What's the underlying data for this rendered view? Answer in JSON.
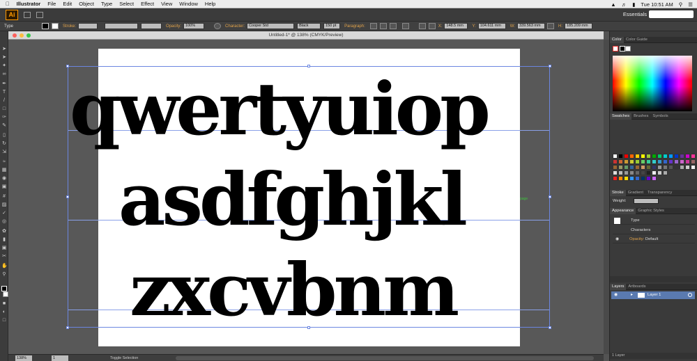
{
  "menubar": {
    "apple": "",
    "app": "Illustrator",
    "items": [
      "File",
      "Edit",
      "Object",
      "Type",
      "Select",
      "Effect",
      "View",
      "Window",
      "Help"
    ],
    "clock": "Tue 10:51 AM"
  },
  "appbar": {
    "logo": "Ai",
    "workspace": "Essentials",
    "search_placeholder": ""
  },
  "control_bar": {
    "type_label": "Type",
    "stroke_label": "Stroke:",
    "opacity_label": "Opacity:",
    "opacity_value": "100%",
    "character_label": "Character:",
    "font_value": "Cooper Std",
    "style_value": "Black",
    "size_value": "150 pt",
    "paragraph_label": "Paragraph:",
    "x_label": "X:",
    "x_value": "148.5 mm",
    "y_label": "Y:",
    "y_value": "104.611 mm",
    "w_label": "W:",
    "w_value": "339.563 mm",
    "h_label": "H:",
    "h_value": "185.209 mm"
  },
  "document": {
    "title": "Untitled-1* @ 138% (CMYK/Preview)",
    "lines": [
      "qwertyuiop",
      "asdfghjkl",
      "zxcvbnm"
    ],
    "green_label": "page"
  },
  "status_bar": {
    "zoom": "138%",
    "page": "1",
    "status": "Toggle Selection"
  },
  "panels": {
    "color_tabs": [
      "Color",
      "Color Guide"
    ],
    "swatch_tabs": [
      "Swatches",
      "Brushes",
      "Symbols"
    ],
    "stroke_tabs": [
      "Stroke",
      "Gradient",
      "Transparency"
    ],
    "weight_label": "Weight:",
    "appearance_tabs": [
      "Appearance",
      "Graphic Styles"
    ],
    "appearance_rows": {
      "type": "Type",
      "characters": "Characters",
      "opacity_label": "Opacity:",
      "opacity_value": "Default"
    },
    "layers_tabs": [
      "Layers",
      "Artboards"
    ],
    "layer_name": "Layer 1",
    "layers_count": "1 Layer"
  },
  "colors": {
    "selection": "#6b86e0",
    "accent_label": "#e0a24a",
    "layer_highlight": "#5a7ab0"
  }
}
